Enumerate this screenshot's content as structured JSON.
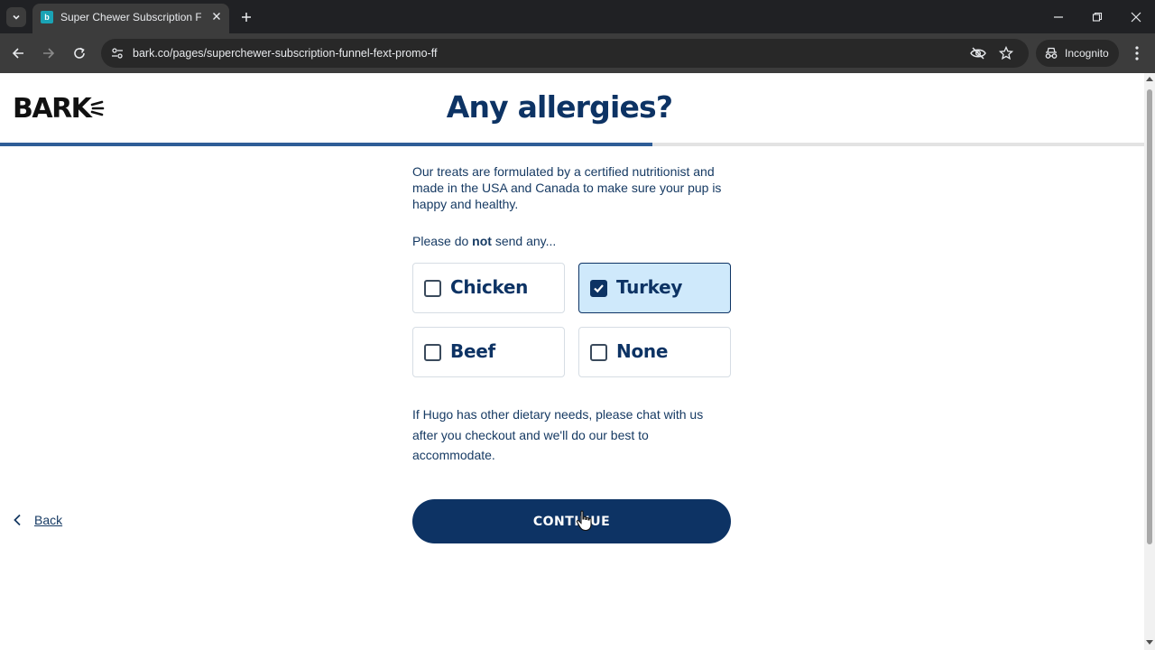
{
  "browser": {
    "tab_title": "Super Chewer Subscription Funnel",
    "url": "bark.co/pages/superchewer-subscription-funnel-fext-promo-ff",
    "incognito_label": "Incognito"
  },
  "page": {
    "logo": "BARK",
    "heading": "Any allergies?",
    "progress_fraction": 0.57,
    "intro": "Our treats are formulated by a certified nutritionist and made in the USA and Canada to make sure your pup is happy and healthy.",
    "prompt_before": "Please do ",
    "prompt_bold": "not",
    "prompt_after": " send any...",
    "options": [
      {
        "label": "Chicken",
        "checked": false
      },
      {
        "label": "Turkey",
        "checked": true
      },
      {
        "label": "Beef",
        "checked": false
      },
      {
        "label": "None",
        "checked": false
      }
    ],
    "note": "If Hugo has other dietary needs, please chat with us after you checkout and we'll do our best to accommodate.",
    "continue_label": "CONTINUE",
    "back_label": "Back"
  },
  "colors": {
    "brand_navy": "#0d3364",
    "selected_bg": "#cfe9fb",
    "progress": "#2e5d97"
  }
}
